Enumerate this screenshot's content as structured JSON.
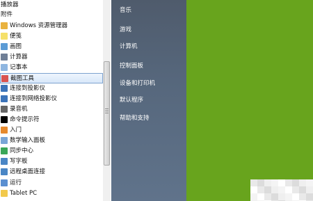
{
  "programs": {
    "items": [
      {
        "label": "播放器",
        "icon": "folder-icon",
        "color": "#f2c94c",
        "has_icon": false
      },
      {
        "label": "附件",
        "icon": "folder-icon",
        "color": "#f2c94c",
        "has_icon": false
      },
      {
        "label": "Windows 资源管理器",
        "icon": "explorer-icon",
        "color": "#e9b23f",
        "has_icon": true
      },
      {
        "label": "便笺",
        "icon": "sticky-note-icon",
        "color": "#f5e06a",
        "has_icon": true
      },
      {
        "label": "画图",
        "icon": "paint-icon",
        "color": "#5b9bd5",
        "has_icon": true
      },
      {
        "label": "计算器",
        "icon": "calculator-icon",
        "color": "#6f7f96",
        "has_icon": true
      },
      {
        "label": "记事本",
        "icon": "notepad-icon",
        "color": "#8fb6e0",
        "has_icon": true
      },
      {
        "label": "截图工具",
        "icon": "snipping-tool-icon",
        "color": "#d9534f",
        "has_icon": true,
        "selected": true
      },
      {
        "label": "连接到投影仪",
        "icon": "projector-icon",
        "color": "#3b73b9",
        "has_icon": true
      },
      {
        "label": "连接到网络投影仪",
        "icon": "network-projector-icon",
        "color": "#3b73b9",
        "has_icon": true
      },
      {
        "label": "录音机",
        "icon": "microphone-icon",
        "color": "#666666",
        "has_icon": true
      },
      {
        "label": "命令提示符",
        "icon": "command-prompt-icon",
        "color": "#000000",
        "has_icon": true
      },
      {
        "label": "入门",
        "icon": "getting-started-icon",
        "color": "#e68a2e",
        "has_icon": true
      },
      {
        "label": "数学输入面板",
        "icon": "math-input-icon",
        "color": "#7aa6d6",
        "has_icon": true
      },
      {
        "label": "同步中心",
        "icon": "sync-center-icon",
        "color": "#3aa657",
        "has_icon": true
      },
      {
        "label": "写字板",
        "icon": "wordpad-icon",
        "color": "#4a86c5",
        "has_icon": true
      },
      {
        "label": "远程桌面连接",
        "icon": "remote-desktop-icon",
        "color": "#4a86c5",
        "has_icon": true
      },
      {
        "label": "运行",
        "icon": "run-icon",
        "color": "#5a8fd0",
        "has_icon": true
      },
      {
        "label": "Tablet PC",
        "icon": "folder-icon",
        "color": "#f2c94c",
        "has_icon": true
      }
    ]
  },
  "places": {
    "items": [
      {
        "label": "音乐"
      },
      {
        "label": "游戏"
      },
      {
        "label": "计算机"
      },
      {
        "label": "控制面板"
      },
      {
        "label": "设备和打印机"
      },
      {
        "label": "默认程序"
      },
      {
        "label": "帮助和支持"
      }
    ]
  },
  "colors": {
    "desktop_green": "#68a41d",
    "places_panel": "#56677c",
    "selection_border": "#7da2ce"
  }
}
